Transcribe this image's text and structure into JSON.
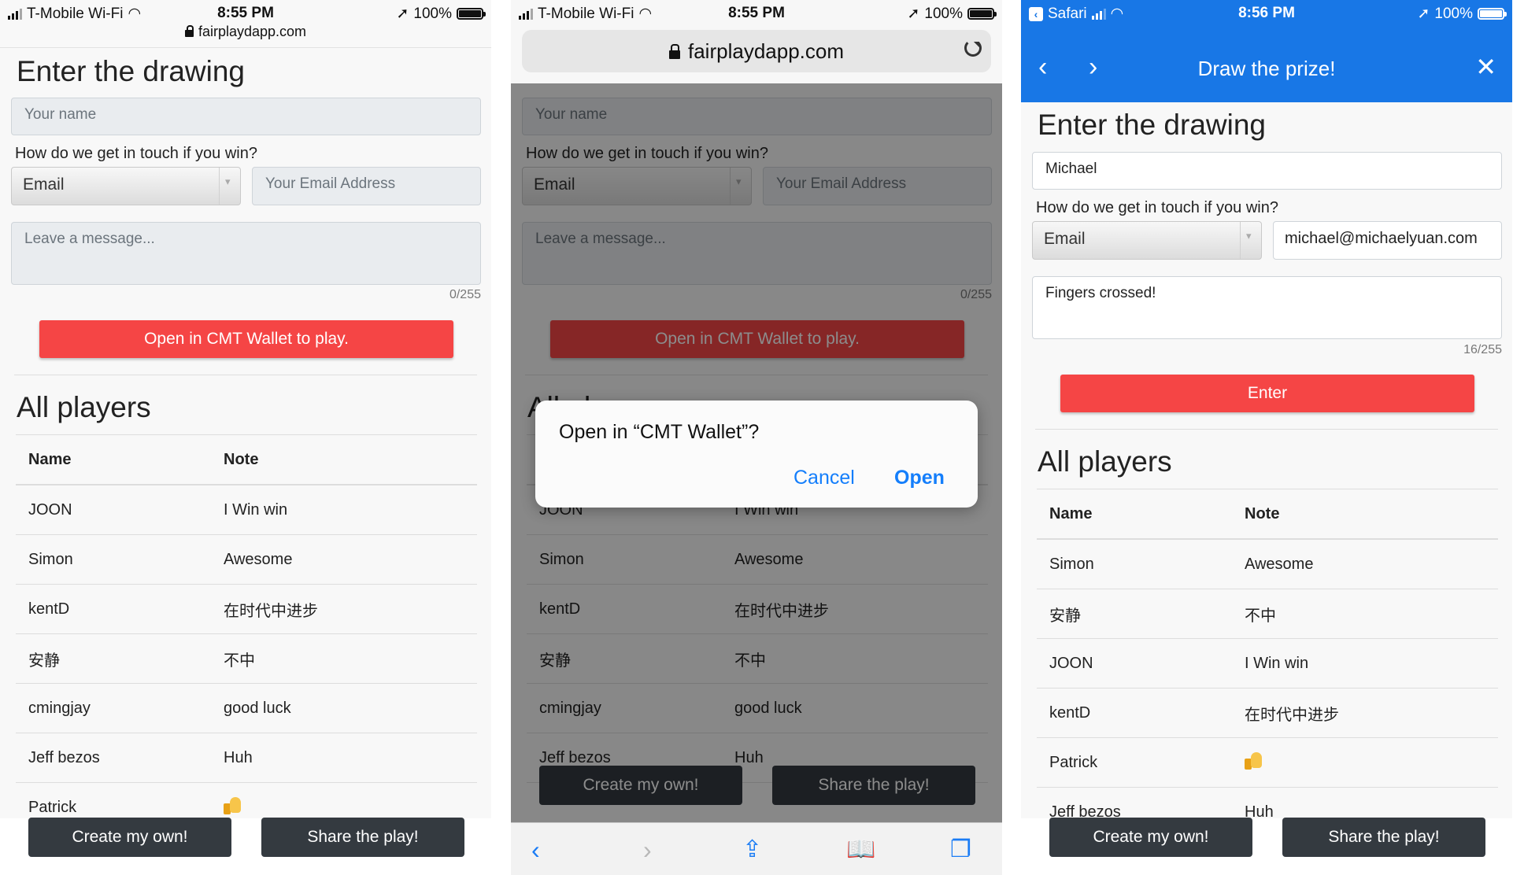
{
  "status": {
    "carrier": "T-Mobile Wi-Fi",
    "time_1": "8:55 PM",
    "time_2": "8:55 PM",
    "time_3": "8:56 PM",
    "battery": "100%",
    "safari_back": "Safari"
  },
  "url": "fairplaydapp.com",
  "form": {
    "heading": "Enter the drawing",
    "name_placeholder": "Your name",
    "name_value": "Michael",
    "contact_label": "How do we get in touch if you win?",
    "contact_method": "Email",
    "email_placeholder": "Your Email Address",
    "email_value": "michael@michaelyuan.com",
    "message_placeholder": "Leave a message...",
    "message_value": "Fingers crossed!",
    "counter_empty": "0/255",
    "counter_filled": "16/255",
    "open_button": "Open in CMT Wallet to play.",
    "enter_button": "Enter"
  },
  "players": {
    "heading": "All players",
    "headers": [
      "Name",
      "Note"
    ],
    "rows_a": [
      {
        "name": "JOON",
        "note": "I Win win"
      },
      {
        "name": "Simon",
        "note": "Awesome"
      },
      {
        "name": "kentD",
        "note": "在时代中进步"
      },
      {
        "name": "安静",
        "note": "不中"
      },
      {
        "name": "cmingjay",
        "note": "good luck"
      },
      {
        "name": "Jeff bezos",
        "note": "Huh"
      },
      {
        "name": "Patrick",
        "note": ""
      }
    ],
    "rows_b": [
      {
        "name": "Simon",
        "note": "Awesome"
      },
      {
        "name": "安静",
        "note": "不中"
      },
      {
        "name": "JOON",
        "note": "I Win win"
      },
      {
        "name": "kentD",
        "note": "在时代中进步"
      },
      {
        "name": "Patrick",
        "note": ""
      },
      {
        "name": "Jeff bezos",
        "note": "Huh"
      }
    ]
  },
  "buttons": {
    "create": "Create my own!",
    "share": "Share the play!"
  },
  "dialog": {
    "question": "Open in “CMT Wallet”?",
    "cancel": "Cancel",
    "open": "Open"
  },
  "webview": {
    "title": "Draw the prize!"
  },
  "colors": {
    "accent_red": "#f54545",
    "dark_button": "#343a40",
    "header_blue": "#1877e6",
    "ios_link_blue": "#147efb"
  },
  "icons": [
    "wifi-icon",
    "location-icon",
    "battery-icon",
    "lock-icon",
    "reload-icon",
    "back-icon",
    "forward-icon",
    "share-icon",
    "bookmarks-icon",
    "tabs-icon",
    "close-icon",
    "thumbs-up-icon"
  ]
}
